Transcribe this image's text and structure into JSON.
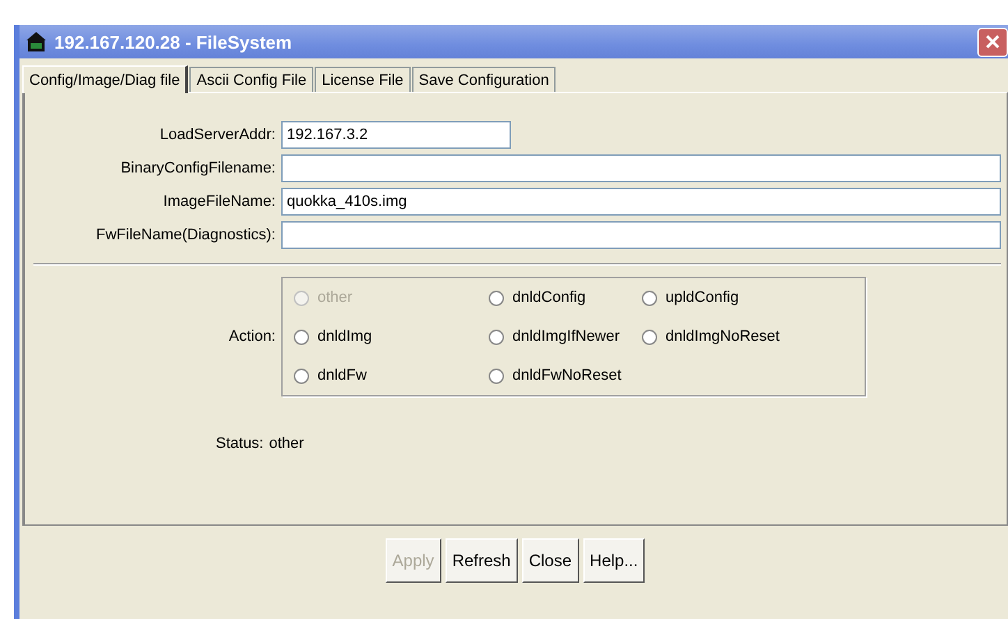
{
  "window": {
    "title": "192.167.120.28 - FileSystem"
  },
  "tabs": [
    {
      "label": "Config/Image/Diag file",
      "selected": true
    },
    {
      "label": "Ascii Config File",
      "selected": false
    },
    {
      "label": "License File",
      "selected": false
    },
    {
      "label": "Save Configuration",
      "selected": false
    }
  ],
  "fields": [
    {
      "label": "LoadServerAddr:",
      "value": "192.167.3.2",
      "kind": "short"
    },
    {
      "label": "BinaryConfigFilename:",
      "kind": "wide"
    },
    {
      "label": "ImageFileName:",
      "value": "quokka_410s.img",
      "kind": "wide"
    },
    {
      "label": "FwFileName(Diagnostics):",
      "kind": "wide"
    }
  ],
  "action": {
    "label": "Action:",
    "options": [
      {
        "label": "other",
        "selected": false,
        "disabled": true
      },
      {
        "label": "dnldConfig",
        "selected": false,
        "disabled": false
      },
      {
        "label": "upldConfig",
        "selected": false,
        "disabled": false
      },
      {
        "label": "dnldImg",
        "selected": false,
        "disabled": false
      },
      {
        "label": "dnldImgIfNewer",
        "selected": false,
        "disabled": false
      },
      {
        "label": "dnldImgNoReset",
        "selected": false,
        "disabled": false
      },
      {
        "label": "dnldFw",
        "selected": false,
        "disabled": false
      },
      {
        "label": "dnldFwNoReset",
        "selected": false,
        "disabled": false
      }
    ]
  },
  "status": {
    "label": "Status:",
    "value": "other"
  },
  "buttons": [
    {
      "label": "Apply",
      "disabled": true
    },
    {
      "label": "Refresh",
      "disabled": false
    },
    {
      "label": "Close",
      "disabled": false
    },
    {
      "label": "Help...",
      "disabled": false
    }
  ]
}
